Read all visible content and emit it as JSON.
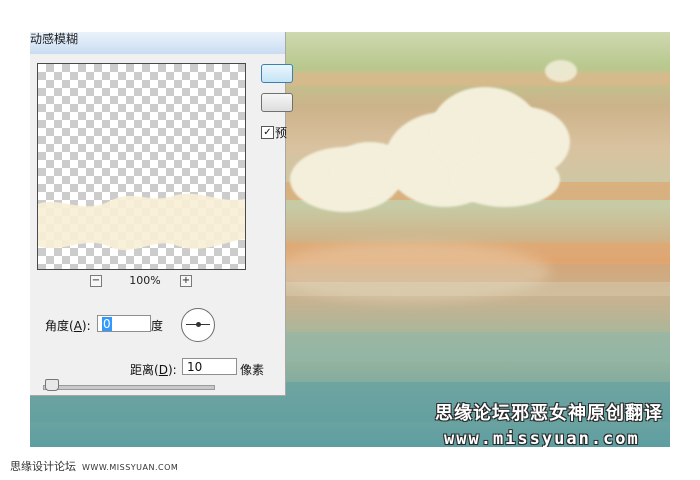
{
  "dialog": {
    "title": "动感模糊",
    "zoom": {
      "minus": "−",
      "plus": "+",
      "value": "100%"
    },
    "angle": {
      "label_prefix": "角度(",
      "label_key": "A",
      "label_suffix": "):",
      "value": "0",
      "unit": "度"
    },
    "distance": {
      "label_prefix": "距离(",
      "label_key": "D",
      "label_suffix": "):",
      "value": "10",
      "unit": "像素",
      "slider_fraction": 0.01
    },
    "preview_checkbox": {
      "checked": true,
      "mark": "✓",
      "label": "预"
    }
  },
  "watermark": {
    "title": "思缘论坛邪恶女神原创翻译",
    "url": "www.missyuan.com"
  },
  "footer": {
    "site_name": "思缘设计论坛",
    "url": "WWW.MISSYUAN.COM"
  },
  "colors": {
    "selection": "#3399ff",
    "dialog_bg": "#f0f0f0",
    "title_bar": "#d7e6f6"
  }
}
